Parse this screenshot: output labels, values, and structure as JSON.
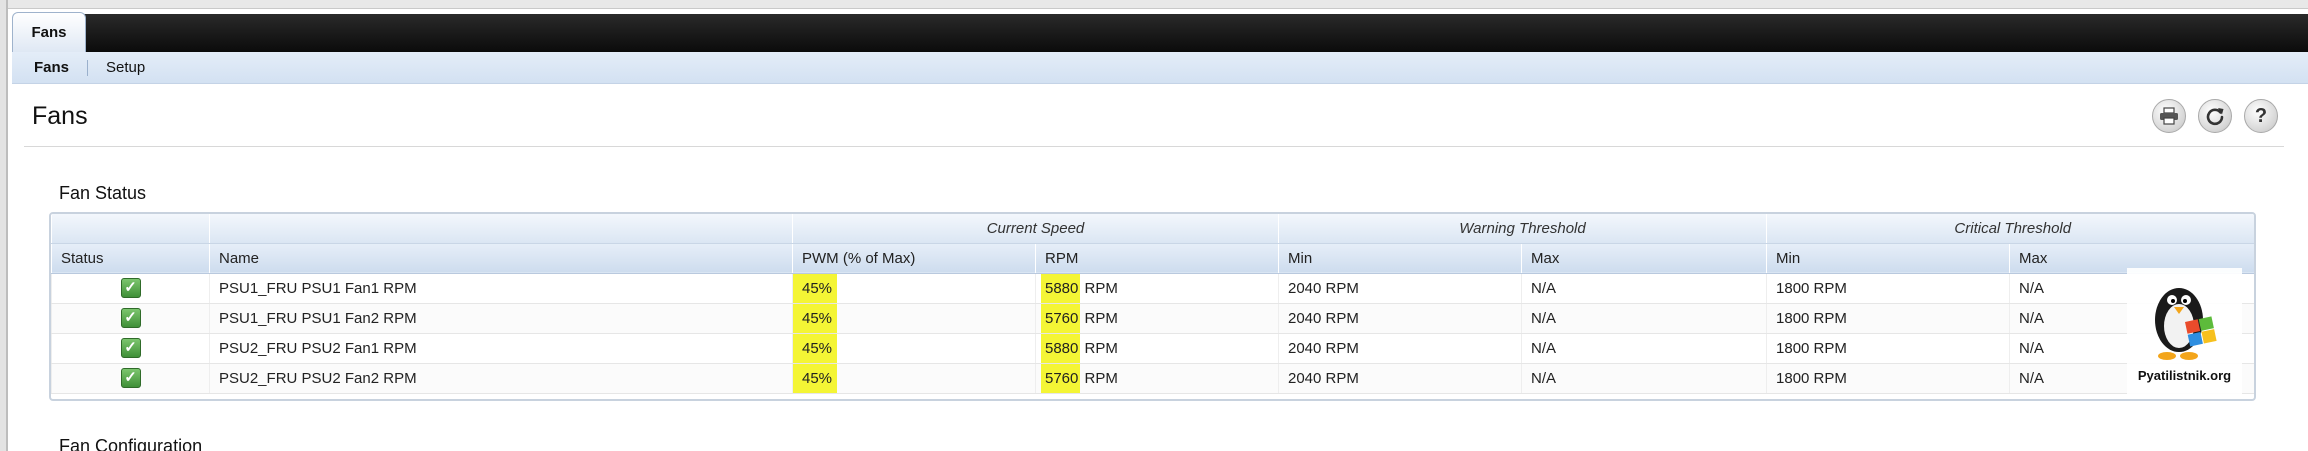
{
  "tabs": {
    "active": "Fans"
  },
  "subnav": {
    "items": [
      "Fans",
      "Setup"
    ]
  },
  "page": {
    "title": "Fans"
  },
  "toolbar": {
    "print_icon": "print-icon",
    "refresh_icon": "refresh-icon",
    "help_icon": "help-icon",
    "help_glyph": "?"
  },
  "fan_status": {
    "title": "Fan Status",
    "group_headers": {
      "current_speed": "Current Speed",
      "warning": "Warning Threshold",
      "critical": "Critical Threshold"
    },
    "columns": {
      "status": "Status",
      "name": "Name",
      "pwm": "PWM (% of Max)",
      "rpm": "RPM",
      "warn_min": "Min",
      "warn_max": "Max",
      "crit_min": "Min",
      "crit_max": "Max"
    },
    "rows": [
      {
        "status": "ok",
        "name": "PSU1_FRU PSU1 Fan1 RPM",
        "pwm": "45%",
        "rpm_value": "5880",
        "rpm_unit": "RPM",
        "warn_min": "2040 RPM",
        "warn_max": "N/A",
        "crit_min": "1800 RPM",
        "crit_max": "N/A"
      },
      {
        "status": "ok",
        "name": "PSU1_FRU PSU1 Fan2 RPM",
        "pwm": "45%",
        "rpm_value": "5760",
        "rpm_unit": "RPM",
        "warn_min": "2040 RPM",
        "warn_max": "N/A",
        "crit_min": "1800 RPM",
        "crit_max": "N/A"
      },
      {
        "status": "ok",
        "name": "PSU2_FRU PSU2 Fan1 RPM",
        "pwm": "45%",
        "rpm_value": "5880",
        "rpm_unit": "RPM",
        "warn_min": "2040 RPM",
        "warn_max": "N/A",
        "crit_min": "1800 RPM",
        "crit_max": "N/A"
      },
      {
        "status": "ok",
        "name": "PSU2_FRU PSU2 Fan2 RPM",
        "pwm": "45%",
        "rpm_value": "5760",
        "rpm_unit": "RPM",
        "warn_min": "2040 RPM",
        "warn_max": "N/A",
        "crit_min": "1800 RPM",
        "crit_max": "N/A"
      }
    ],
    "highlight_color": "#f4f535",
    "status_icon": "check-icon",
    "status_glyph": "✓"
  },
  "next_section": {
    "title": "Fan Configuration"
  },
  "watermark": {
    "text": "Pyatilistnik.org"
  }
}
